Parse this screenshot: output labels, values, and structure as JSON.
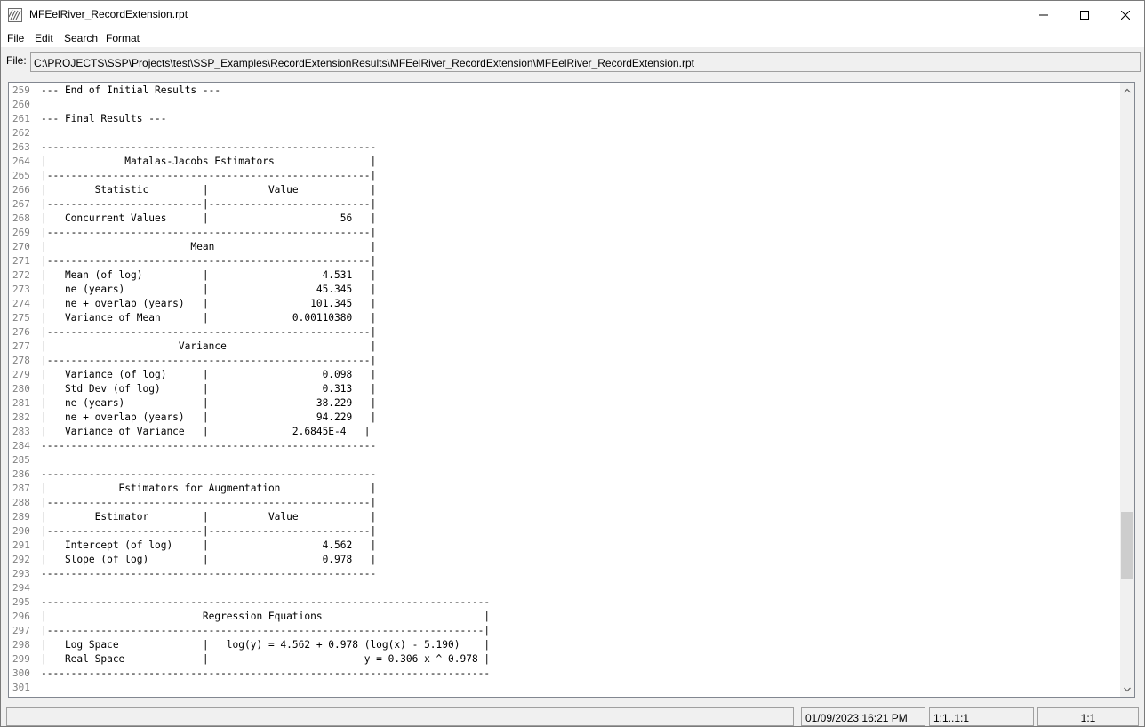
{
  "window": {
    "title": "MFEelRiver_RecordExtension.rpt",
    "icon": "report-file-icon"
  },
  "menu": {
    "items": [
      "File",
      "Edit",
      "Search",
      "Format"
    ]
  },
  "file_bar": {
    "label": "File:",
    "path": "C:\\PROJECTS\\SSP\\Projects\\test\\SSP_Examples\\RecordExtensionResults\\MFEelRiver_RecordExtension\\MFEelRiver_RecordExtension.rpt"
  },
  "editor": {
    "line_numbers": [
      "259",
      "260",
      "261",
      "262",
      "263",
      "264",
      "265",
      "266",
      "267",
      "268",
      "269",
      "270",
      "271",
      "272",
      "273",
      "274",
      "275",
      "276",
      "277",
      "278",
      "279",
      "280",
      "281",
      "282",
      "283",
      "284",
      "285",
      "286",
      "287",
      "288",
      "289",
      "290",
      "291",
      "292",
      "293",
      "294",
      "295",
      "296",
      "297",
      "298",
      "299",
      "300",
      "301"
    ],
    "lines": [
      "--- End of Initial Results ---",
      "",
      "--- Final Results ---",
      "",
      "--------------------------------------------------------",
      "|             Matalas-Jacobs Estimators                |",
      "|------------------------------------------------------|",
      "|        Statistic         |          Value            |",
      "|--------------------------|---------------------------|",
      "|   Concurrent Values      |                      56   |",
      "|------------------------------------------------------|",
      "|                        Mean                          |",
      "|------------------------------------------------------|",
      "|   Mean (of log)          |                   4.531   |",
      "|   ne (years)             |                  45.345   |",
      "|   ne + overlap (years)   |                 101.345   |",
      "|   Variance of Mean       |              0.00110380   |",
      "|------------------------------------------------------|",
      "|                      Variance                        |",
      "|------------------------------------------------------|",
      "|   Variance (of log)      |                   0.098   |",
      "|   Std Dev (of log)       |                   0.313   |",
      "|   ne (years)             |                  38.229   |",
      "|   ne + overlap (years)   |                  94.229   |",
      "|   Variance of Variance   |              2.6845E-4   |",
      "--------------------------------------------------------",
      "",
      "--------------------------------------------------------",
      "|            Estimators for Augmentation               |",
      "|------------------------------------------------------|",
      "|        Estimator         |          Value            |",
      "|--------------------------|---------------------------|",
      "|   Intercept (of log)     |                   4.562   |",
      "|   Slope (of log)         |                   0.978   |",
      "--------------------------------------------------------",
      "",
      "---------------------------------------------------------------------------",
      "|                          Regression Equations                           |",
      "|-------------------------------------------------------------------------|",
      "|   Log Space              |   log(y) = 4.562 + 0.978 (log(x) - 5.190)    |",
      "|   Real Space             |                          y = 0.306 x ^ 0.978 |",
      "---------------------------------------------------------------------------",
      ""
    ]
  },
  "status": {
    "pane1": "",
    "datetime": "01/09/2023 16:21 PM",
    "selection": "1:1..1:1",
    "position": "1:1"
  }
}
